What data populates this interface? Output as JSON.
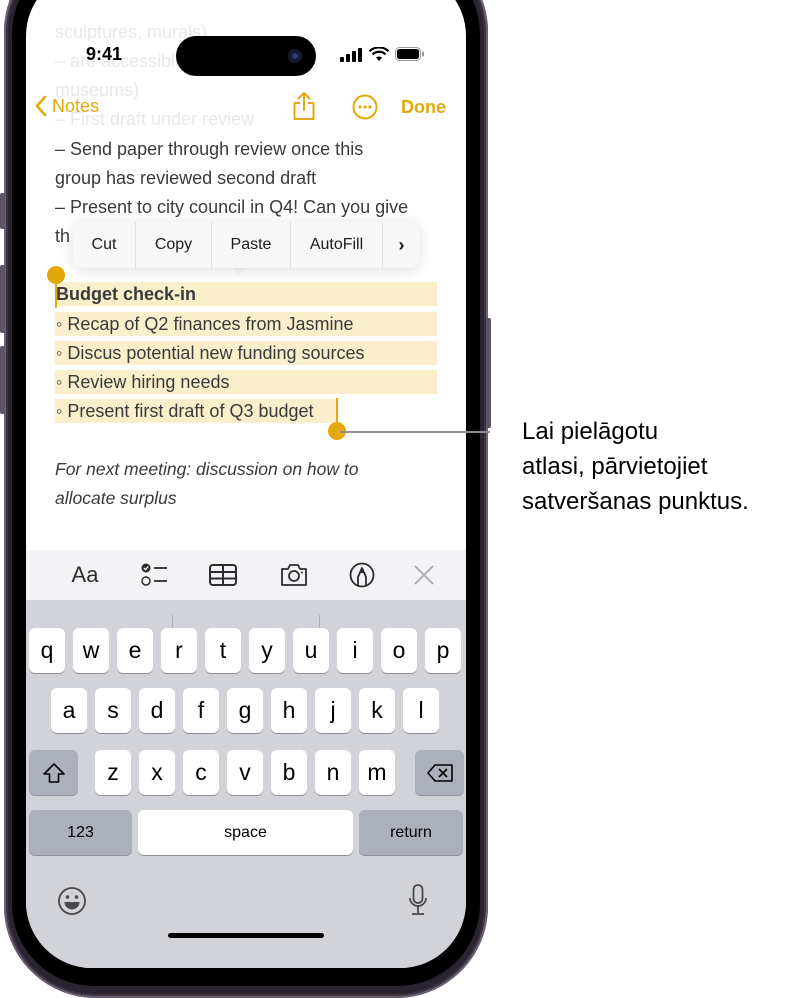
{
  "status_bar": {
    "time": "9:41"
  },
  "background_text": [
    "sculptures, murals)",
    "– are accessible to all (free",
    "museums)",
    "– First draft under review"
  ],
  "nav": {
    "back_label": "Notes",
    "share_icon": "share-icon",
    "more_icon": "ellipsis-circle-icon",
    "done_label": "Done",
    "accent_color": "#e4a80a"
  },
  "note": {
    "lines_before": [
      "– Send paper through review once this",
      "group has reviewed second draft",
      "– Present to city council in Q4! Can you give",
      "th"
    ],
    "selected": {
      "title": "Budget check-in",
      "bullets": [
        "◦ Recap of Q2 finances from Jasmine",
        "◦ Discus potential new funding sources",
        "◦ Review hiring needs",
        "◦ Present first draft of Q3 budget"
      ],
      "highlight_color": "#faeecb"
    },
    "italic_lines": [
      "For next meeting: discussion on how to",
      "allocate surplus"
    ]
  },
  "context_menu": {
    "items": [
      "Cut",
      "Copy",
      "Paste",
      "AutoFill"
    ],
    "more_label": "›"
  },
  "format_toolbar": {
    "text_style_label": "Aa",
    "icons": [
      "checklist-icon",
      "table-icon",
      "camera-icon",
      "markup-icon",
      "close-icon"
    ]
  },
  "keyboard": {
    "row1": [
      "q",
      "w",
      "e",
      "r",
      "t",
      "y",
      "u",
      "i",
      "o",
      "p"
    ],
    "row2": [
      "a",
      "s",
      "d",
      "f",
      "g",
      "h",
      "j",
      "k",
      "l"
    ],
    "row3": [
      "z",
      "x",
      "c",
      "v",
      "b",
      "n",
      "m"
    ],
    "numbers_label": "123",
    "space_label": "space",
    "return_label": "return"
  },
  "callout": {
    "lines": [
      "Lai pielāgotu",
      "atlasi, pārvietojiet",
      "satveršanas punktus."
    ]
  }
}
